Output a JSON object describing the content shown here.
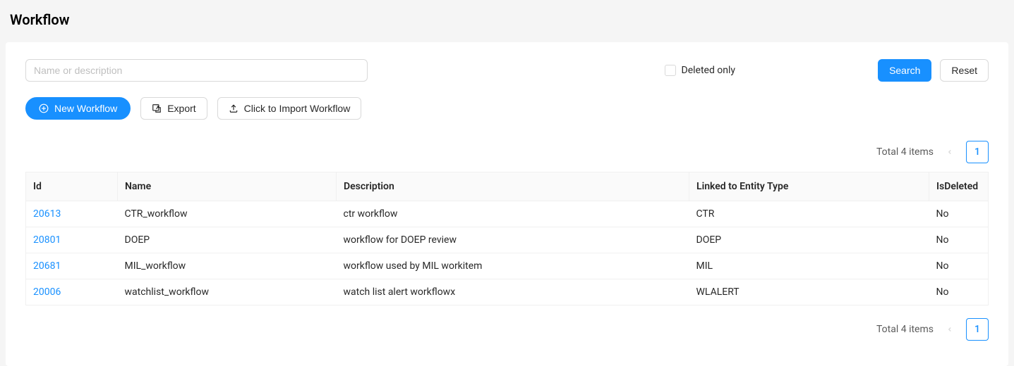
{
  "page": {
    "title": "Workflow"
  },
  "filter": {
    "search_placeholder": "Name or description",
    "deleted_only_label": "Deleted only",
    "search_button": "Search",
    "reset_button": "Reset"
  },
  "actions": {
    "new_label": "New Workflow",
    "export_label": "Export",
    "import_label": "Click to Import Workflow"
  },
  "pagination": {
    "total_text": "Total 4 items",
    "current_page": "1"
  },
  "table": {
    "headers": {
      "id": "Id",
      "name": "Name",
      "description": "Description",
      "entity": "Linked to Entity Type",
      "deleted": "IsDeleted"
    },
    "rows": [
      {
        "id": "20613",
        "name": "CTR_workflow",
        "description": "ctr workflow",
        "entity": "CTR",
        "deleted": "No"
      },
      {
        "id": "20801",
        "name": "DOEP",
        "description": "workflow for DOEP review",
        "entity": "DOEP",
        "deleted": "No"
      },
      {
        "id": "20681",
        "name": "MIL_workflow",
        "description": "workflow used by MIL workitem",
        "entity": "MIL",
        "deleted": "No"
      },
      {
        "id": "20006",
        "name": "watchlist_workflow",
        "description": "watch list alert workflowx",
        "entity": "WLALERT",
        "deleted": "No"
      }
    ]
  }
}
